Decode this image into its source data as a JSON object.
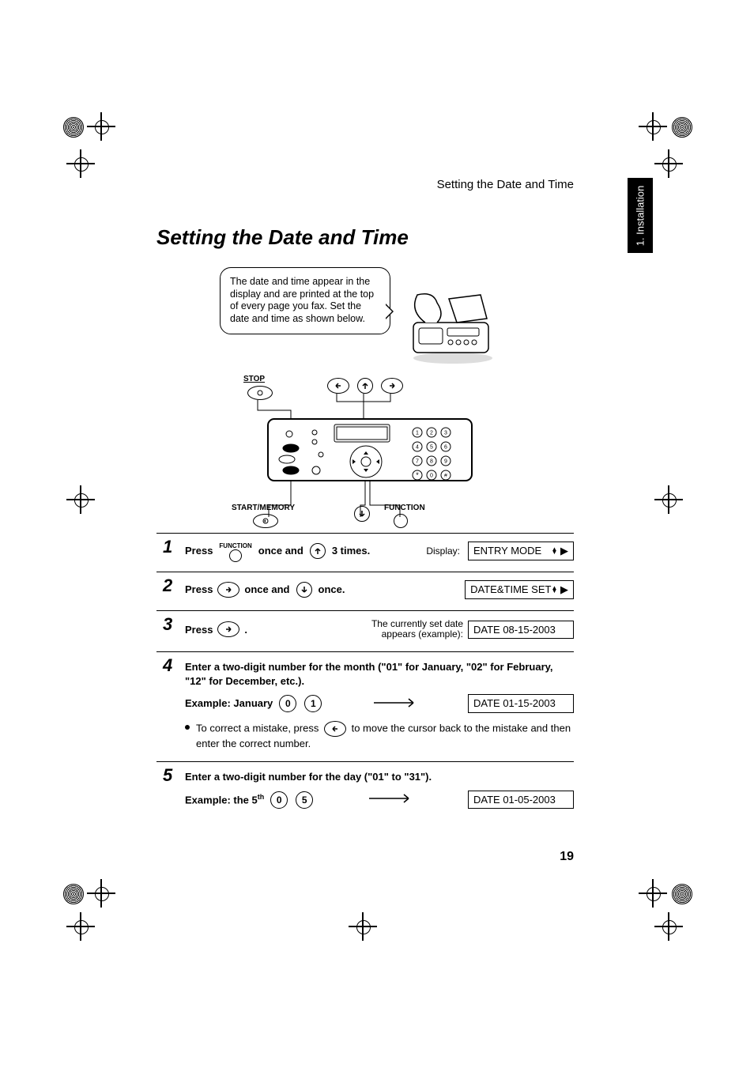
{
  "header": {
    "page_topic": "Setting the Date and Time",
    "side_tab": "1. Installation"
  },
  "title": "Setting the Date and Time",
  "bubble_text": "The date and time appear in the display and are printed at the top of every page you fax. Set the date and time as shown below.",
  "diagram": {
    "label_stop": "STOP",
    "label_start_memory": "START/MEMORY",
    "label_function": "FUNCTION",
    "keypad": [
      "1",
      "2",
      "3",
      "4",
      "5",
      "6",
      "7",
      "8",
      "9",
      "*",
      "0",
      "#"
    ]
  },
  "steps": {
    "s1": {
      "num": "1",
      "press": "Press",
      "func_label": "FUNCTION",
      "middle": "once and",
      "tail": "3 times.",
      "display_label": "Display:",
      "lcd": "ENTRY MODE"
    },
    "s2": {
      "num": "2",
      "press": "Press",
      "mid1": "once and",
      "mid2": "once.",
      "lcd": "DATE&TIME SET"
    },
    "s3": {
      "num": "3",
      "press": "Press",
      "dot": ".",
      "note1": "The currently set date",
      "note2": "appears (example):",
      "lcd": "DATE 08-15-2003"
    },
    "s4": {
      "num": "4",
      "main": "Enter a two-digit number for the month (\"01\" for January, \"02\" for February, \"12\" for December, etc.).",
      "example_label": "Example: January",
      "key1": "0",
      "key2": "1",
      "lcd": "DATE 01-15-2003",
      "bullet_a": "To correct a mistake, press",
      "bullet_b": "to move the cursor back to the mistake and then enter the correct number."
    },
    "s5": {
      "num": "5",
      "main": "Enter a two-digit number for the day (\"01\" to \"31\").",
      "example_label": "Example: the 5",
      "example_sup": "th",
      "key1": "0",
      "key2": "5",
      "lcd": "DATE 01-05-2003"
    }
  },
  "page_number": "19"
}
